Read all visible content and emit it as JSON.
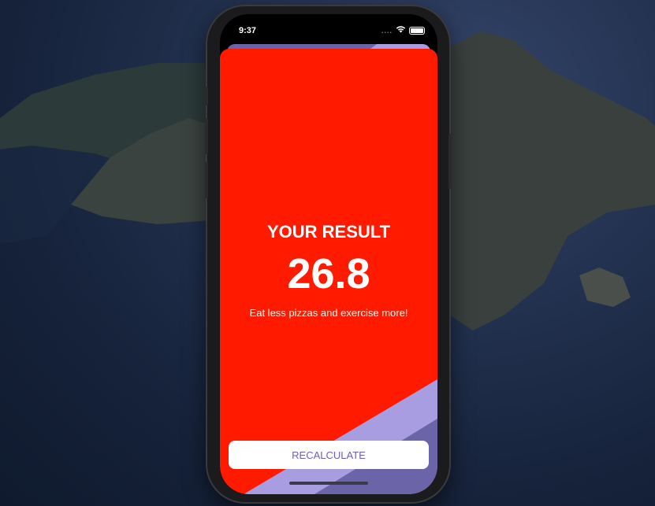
{
  "status_bar": {
    "time": "9:37",
    "signal": "....",
    "wifi_icon": "wifi-icon",
    "battery_icon": "battery-icon"
  },
  "result": {
    "title": "YOUR RESULT",
    "value": "26.8",
    "advice": "Eat less pizzas and exercise more!"
  },
  "actions": {
    "recalculate_label": "RECALCULATE"
  },
  "colors": {
    "card": "#ff1a00",
    "accent": "#6a5fc1",
    "stripe_light": "#a89de0",
    "stripe_dark": "#6b64a8"
  }
}
